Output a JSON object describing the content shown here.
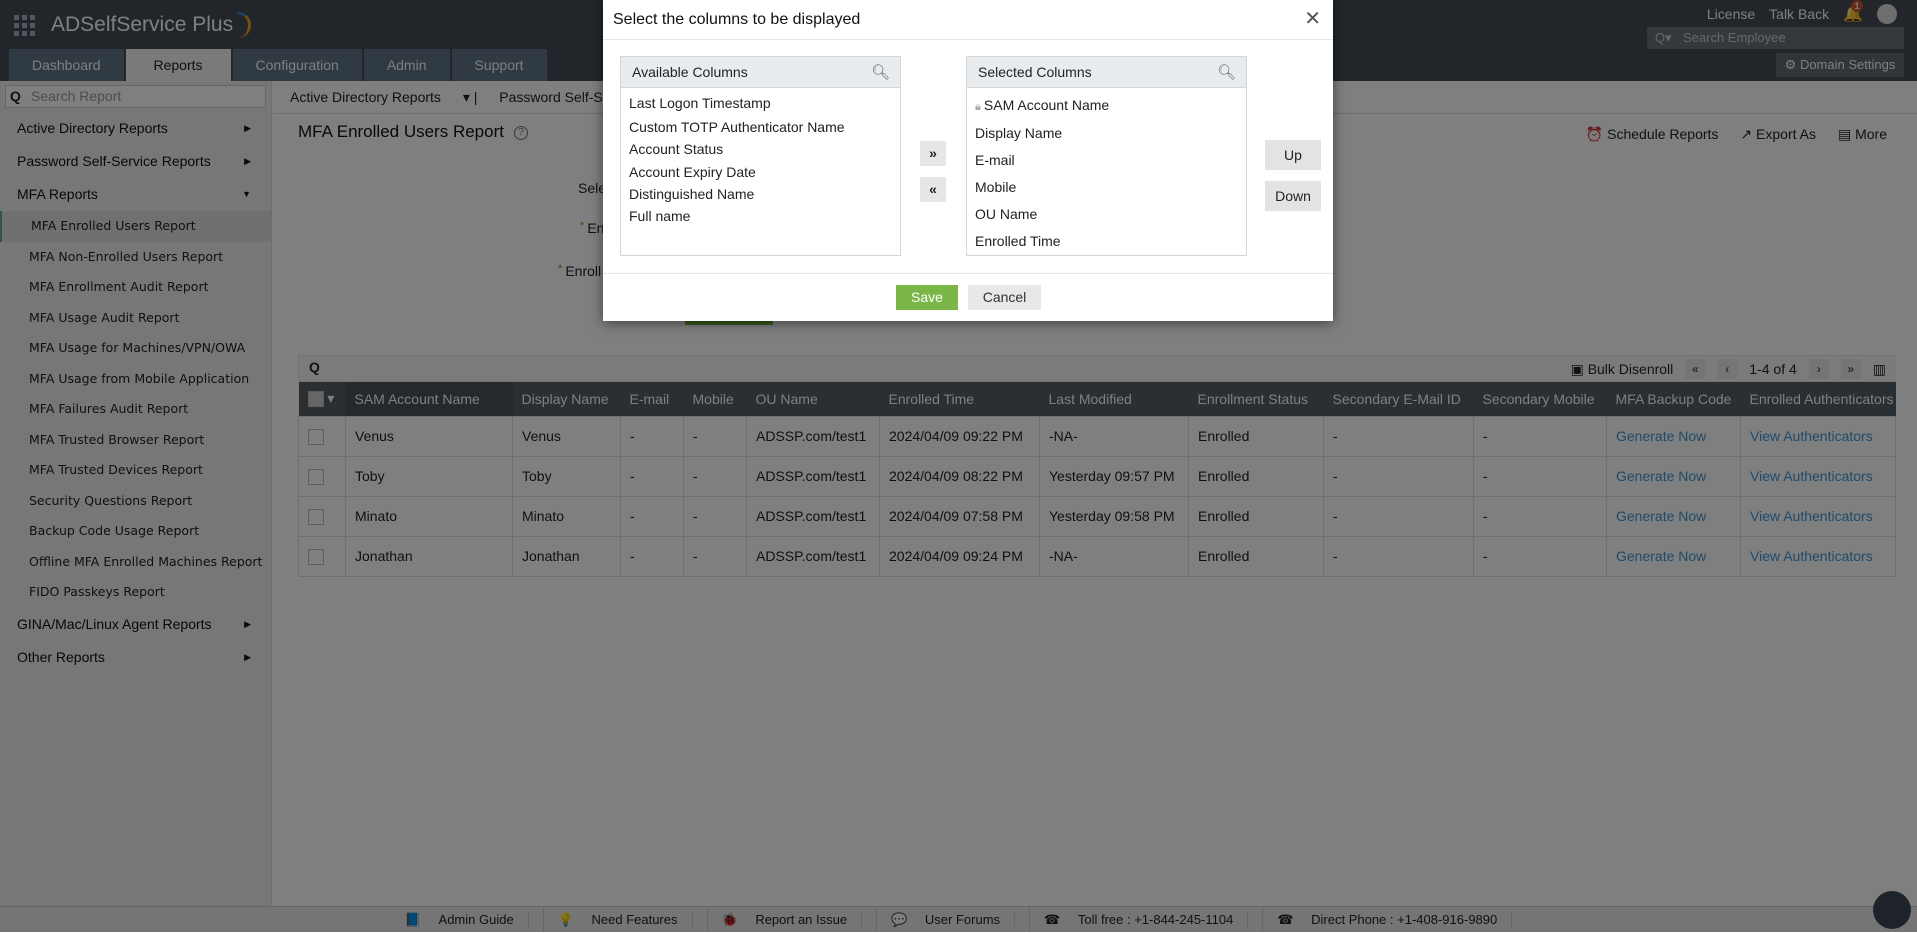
{
  "app": {
    "title": "ADSelfService Plus"
  },
  "nav": {
    "tabs": [
      "Dashboard",
      "Reports",
      "Configuration",
      "Admin",
      "Support"
    ],
    "active": "Reports"
  },
  "top": {
    "license": "License",
    "talk_back": "Talk Back",
    "notif_count": "1",
    "search_placeholder": "Search Employee",
    "domain_settings": "Domain Settings"
  },
  "sidebar": {
    "search_placeholder": "Search Report",
    "groups_top": [
      "Active Directory Reports",
      "Password Self-Service Reports",
      "MFA Reports"
    ],
    "items": [
      "MFA Enrolled Users Report",
      "MFA Non-Enrolled Users Report",
      "MFA Enrollment Audit Report",
      "MFA Usage Audit Report",
      "MFA Usage for Machines/VPN/OWA",
      "MFA Usage from Mobile Application",
      "MFA Failures Audit Report",
      "MFA Trusted Browser Report",
      "MFA Trusted Devices Report",
      "Security Questions Report",
      "Backup Code Usage Report",
      "Offline MFA Enrolled Machines Report",
      "FIDO Passkeys Report"
    ],
    "groups_bottom": [
      "GINA/Mac/Linux Agent Reports",
      "Other Reports"
    ]
  },
  "subnav": [
    "Active Directory Reports",
    "Password Self-Ser"
  ],
  "page": {
    "title": "MFA Enrolled Users Report",
    "help": "?",
    "schedule": "Schedule Reports",
    "export": "Export As",
    "more": "More",
    "form_labels": [
      "Sele",
      "En",
      "Enroll"
    ]
  },
  "toolbar": {
    "bulk": "Bulk Disenroll",
    "range": "1-4 of 4"
  },
  "table": {
    "headers": [
      "SAM Account Name",
      "Display Name",
      "E-mail",
      "Mobile",
      "OU Name",
      "Enrolled Time",
      "Last Modified",
      "Enrollment Status",
      "Secondary E-Mail ID",
      "Secondary Mobile",
      "MFA Backup Code",
      "Enrolled Authenticators"
    ],
    "rows": [
      [
        "Venus",
        "Venus",
        "-",
        "-",
        "ADSSP.com/test1",
        "2024/04/09 09:22 PM",
        "-NA-",
        "Enrolled",
        "-",
        "-",
        "Generate Now",
        "View Authenticators"
      ],
      [
        "Toby",
        "Toby",
        "-",
        "-",
        "ADSSP.com/test1",
        "2024/04/09 08:22 PM",
        "Yesterday 09:57 PM",
        "Enrolled",
        "-",
        "-",
        "Generate Now",
        "View Authenticators"
      ],
      [
        "Minato",
        "Minato",
        "-",
        "-",
        "ADSSP.com/test1",
        "2024/04/09 07:58 PM",
        "Yesterday 09:58 PM",
        "Enrolled",
        "-",
        "-",
        "Generate Now",
        "View Authenticators"
      ],
      [
        "Jonathan",
        "Jonathan",
        "-",
        "-",
        "ADSSP.com/test1",
        "2024/04/09 09:24 PM",
        "-NA-",
        "Enrolled",
        "-",
        "-",
        "Generate Now",
        "View Authenticators"
      ]
    ]
  },
  "footer": [
    "Admin Guide",
    "Need Features",
    "Report an Issue",
    "User Forums",
    "Toll free : +1-844-245-1104",
    "Direct Phone : +1-408-916-9890"
  ],
  "modal": {
    "title": "Select the columns to be displayed",
    "available_title": "Available Columns",
    "available": [
      "Last Logon Timestamp",
      "Custom TOTP Authenticator Name",
      "Account Status",
      "Account Expiry Date",
      "Distinguished Name",
      "Full name"
    ],
    "selected_title": "Selected Columns",
    "selected": [
      "SAM Account Name",
      "Display Name",
      "E-mail",
      "Mobile",
      "OU Name",
      "Enrolled Time"
    ],
    "add": "»",
    "remove": "«",
    "up": "Up",
    "down": "Down",
    "save": "Save",
    "cancel": "Cancel"
  },
  "colors": {
    "save": "#7ab648",
    "link": "#3e94d4",
    "overlay": "rgba(0,0,0,0.5)"
  }
}
